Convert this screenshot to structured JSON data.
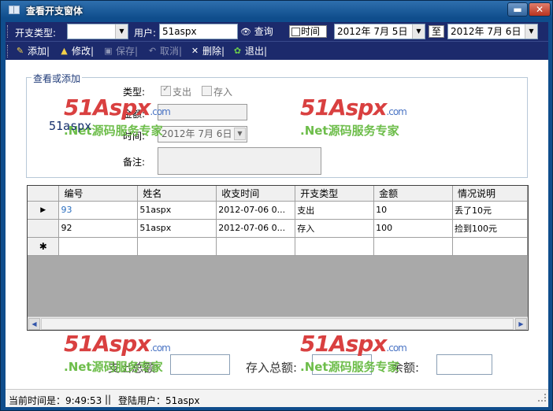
{
  "window": {
    "title": "查看开支窗体",
    "minimize": "▬",
    "close": "✕"
  },
  "query_bar": {
    "type_label": "开支类型:",
    "type_value": "",
    "user_label": "用户:",
    "user_value": "51aspx",
    "search_label": "查询",
    "time_label": "时间",
    "date_from": "2012年 7月 5日",
    "to_label": "至",
    "date_to": "2012年 7月 6日"
  },
  "action_bar": {
    "add": "添加|",
    "edit": "修改|",
    "save": "保存|",
    "cancel": "取消|",
    "delete": "删除|",
    "exit": "退出|"
  },
  "form": {
    "group_title": "查看或添加",
    "type_label": "类型:",
    "expense_label": "支出",
    "deposit_label": "存入",
    "amount_label": "金额:",
    "time_label": "时间:",
    "time_value": "2012年 7月 6日",
    "note_label": "备注:"
  },
  "grid": {
    "columns": [
      "编号",
      "姓名",
      "收支时间",
      "开支类型",
      "金额",
      "情况说明"
    ],
    "rows": [
      [
        "93",
        "51aspx",
        "2012-07-06 0...",
        "支出",
        "10",
        "丢了10元"
      ],
      [
        "92",
        "51aspx",
        "2012-07-06 0...",
        "存入",
        "100",
        "捡到100元"
      ]
    ]
  },
  "totals": {
    "expense_total_label": "支出总额:",
    "deposit_total_label": "存入总额:",
    "balance_label": "余额:"
  },
  "statusbar": {
    "time_text": "当前时间是：9:49:53",
    "divider": "||",
    "user_text": "登陆用户：51aspx"
  },
  "watermark": {
    "logo": "51Aspx",
    "domain": ".com",
    "slogan": ".Net源码服务专家",
    "user": "51aspx"
  },
  "colors": {
    "toolbar": "#1c2a6c",
    "titlebar": "#0f4d8c",
    "group_title": "#1e3a78"
  }
}
